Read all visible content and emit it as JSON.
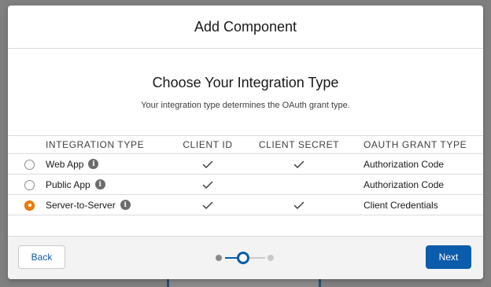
{
  "modal": {
    "title": "Add Component"
  },
  "body": {
    "title": "Choose Your Integration Type",
    "subtitle": "Your integration type determines the OAuth grant type."
  },
  "table": {
    "headers": {
      "type": "INTEGRATION TYPE",
      "client_id": "CLIENT ID",
      "client_secret": "CLIENT SECRET",
      "grant": "OAUTH GRANT TYPE"
    },
    "rows": [
      {
        "type": "Web App",
        "client_id": true,
        "client_secret": true,
        "grant": "Authorization Code",
        "selected": false
      },
      {
        "type": "Public App",
        "client_id": true,
        "client_secret": false,
        "grant": "Authorization Code",
        "selected": false
      },
      {
        "type": "Server-to-Server",
        "client_id": true,
        "client_secret": true,
        "grant": "Client Credentials",
        "selected": true
      }
    ]
  },
  "footer": {
    "back_label": "Back",
    "next_label": "Next",
    "progress": {
      "steps": 3,
      "current_step": 2
    }
  },
  "icons": {
    "info": "info-icon",
    "check": "checkmark-icon",
    "radio": "radio-button"
  },
  "colors": {
    "brand": "#0b5cab",
    "selected_radio": "#f07d00",
    "overlay": "#7f7f7f"
  }
}
